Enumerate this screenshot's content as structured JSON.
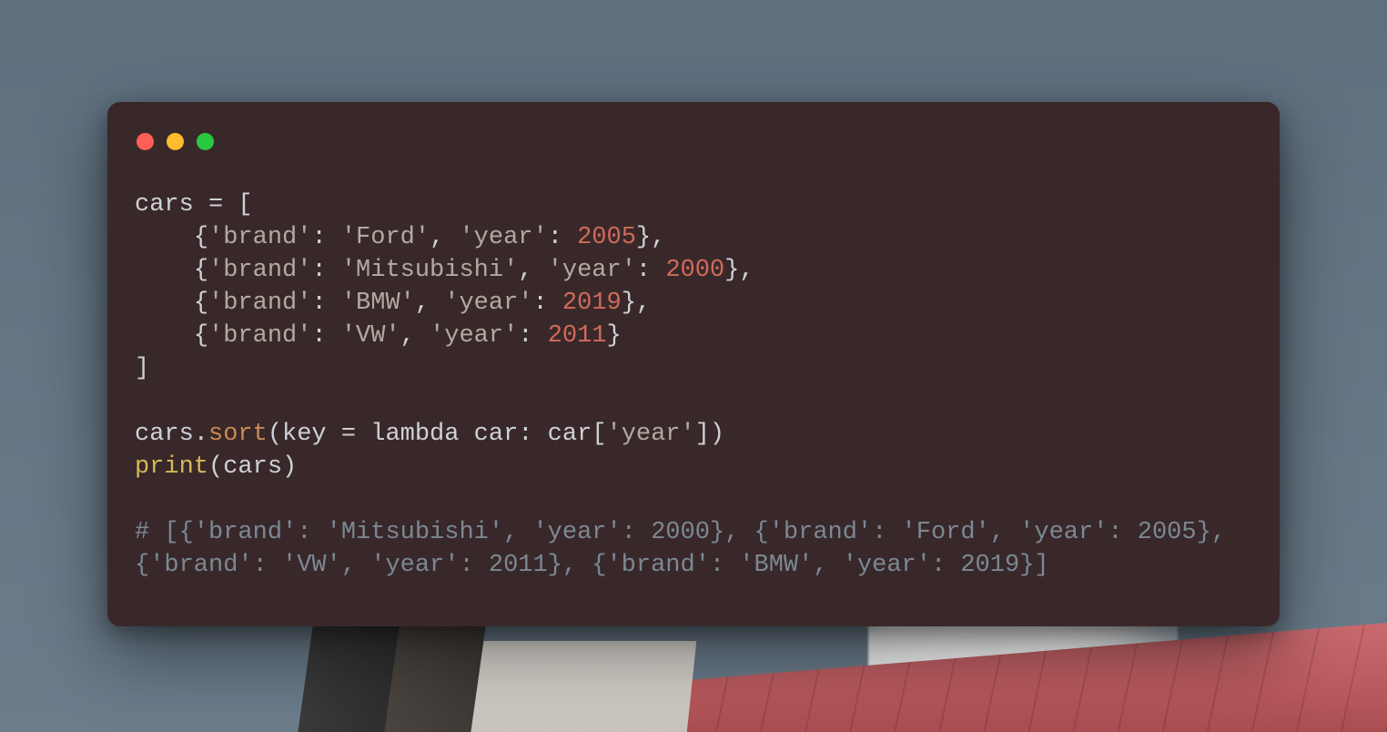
{
  "window": {
    "traffic_lights": [
      "close",
      "minimize",
      "zoom"
    ]
  },
  "code": {
    "variable": "cars",
    "assign_open": " = [",
    "indent": "    ",
    "entries": [
      {
        "brand_key": "'brand'",
        "brand_val": "'Ford'",
        "year_key": "'year'",
        "year_val": "2005"
      },
      {
        "brand_key": "'brand'",
        "brand_val": "'Mitsubishi'",
        "year_key": "'year'",
        "year_val": "2000"
      },
      {
        "brand_key": "'brand'",
        "brand_val": "'BMW'",
        "year_key": "'year'",
        "year_val": "2019"
      },
      {
        "brand_key": "'brand'",
        "brand_val": "'VW'",
        "year_key": "'year'",
        "year_val": "2011"
      }
    ],
    "close_bracket": "]",
    "sort_call_obj": "cars.",
    "sort_method": "sort",
    "sort_args_open": "(key = ",
    "lambda_kw": "lambda",
    "lambda_rest": " car: car[",
    "lambda_key": "'year'",
    "lambda_close": "])",
    "print_fn": "print",
    "print_args": "(cars)",
    "comment_output": "# [{'brand': 'Mitsubishi', 'year': 2000}, {'brand': 'Ford', 'year': 2005}, {'brand': 'VW', 'year': 2011}, {'brand': 'BMW', 'year': 2019}]"
  }
}
